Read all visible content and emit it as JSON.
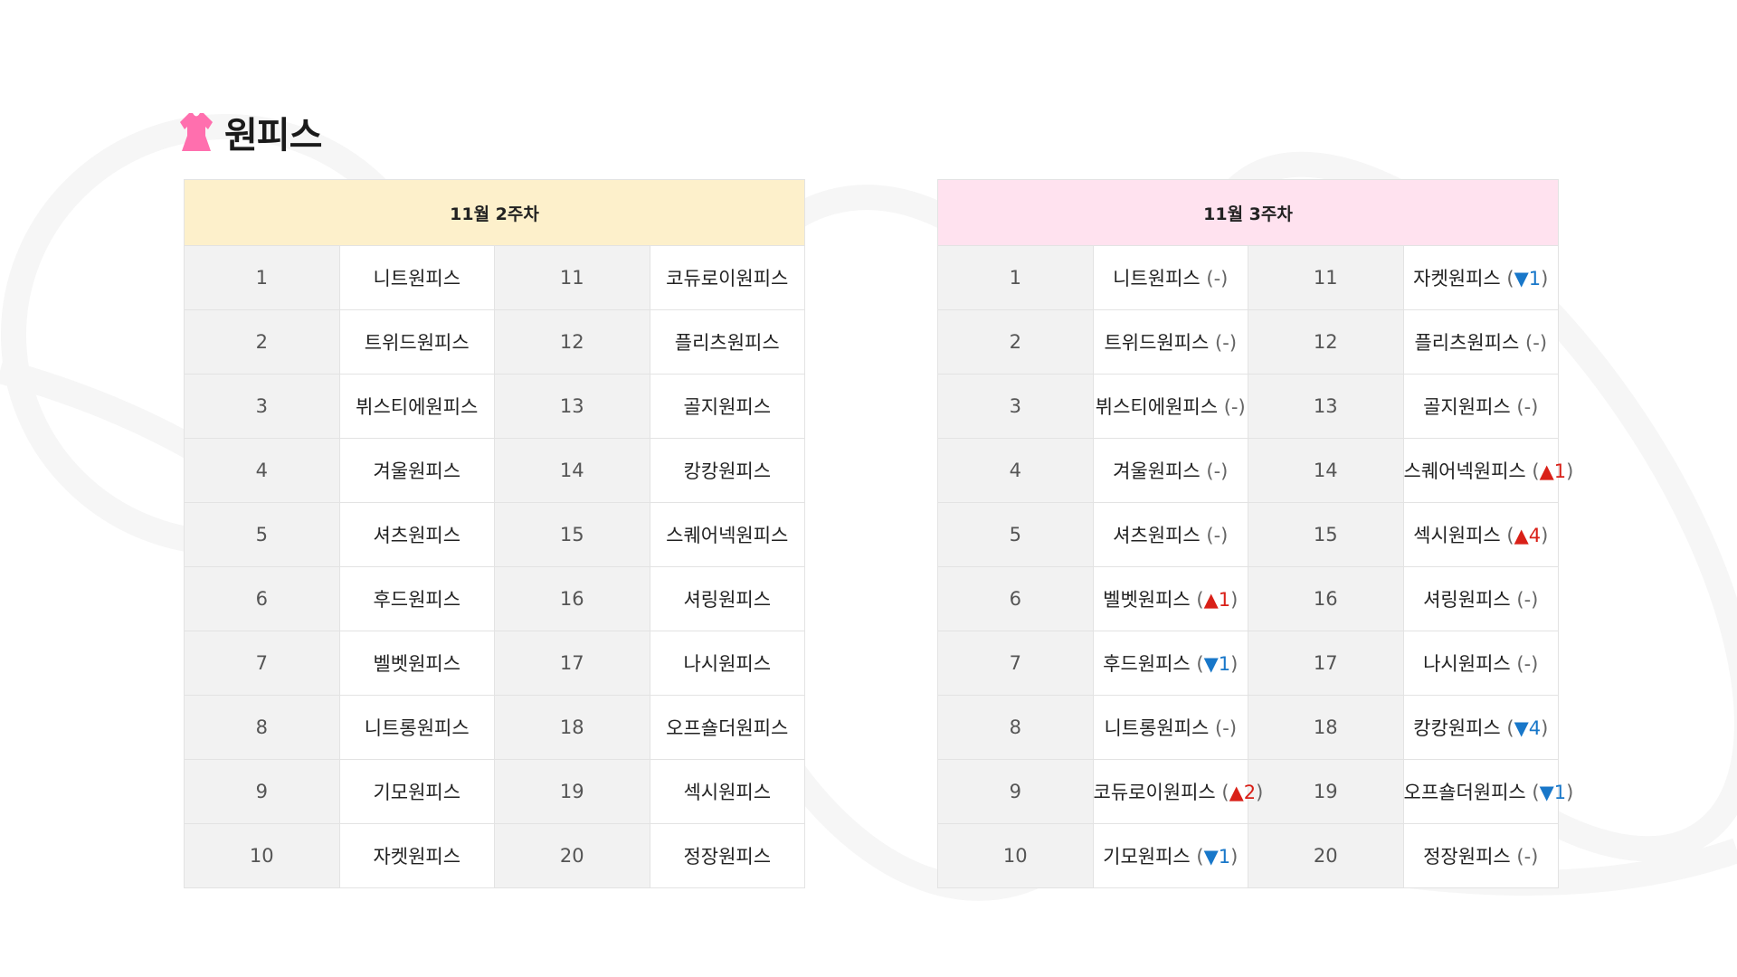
{
  "section": {
    "title": "원피스",
    "icon": "dress-icon",
    "icon_color": "#ff6fae"
  },
  "colors": {
    "week1_header_bg": "#fdf0cb",
    "week2_header_bg": "#ffe2ef",
    "up": "#d92018",
    "down": "#1877c9"
  },
  "week1": {
    "label": "11월 2주차",
    "rows": [
      {
        "rank": "1",
        "name": "니트원피스"
      },
      {
        "rank": "2",
        "name": "트위드원피스"
      },
      {
        "rank": "3",
        "name": "뷔스티에원피스"
      },
      {
        "rank": "4",
        "name": "겨울원피스"
      },
      {
        "rank": "5",
        "name": "셔츠원피스"
      },
      {
        "rank": "6",
        "name": "후드원피스"
      },
      {
        "rank": "7",
        "name": "벨벳원피스"
      },
      {
        "rank": "8",
        "name": "니트롱원피스"
      },
      {
        "rank": "9",
        "name": "기모원피스"
      },
      {
        "rank": "10",
        "name": "자켓원피스"
      },
      {
        "rank": "11",
        "name": "코듀로이원피스"
      },
      {
        "rank": "12",
        "name": "플리츠원피스"
      },
      {
        "rank": "13",
        "name": "골지원피스"
      },
      {
        "rank": "14",
        "name": "캉캉원피스"
      },
      {
        "rank": "15",
        "name": "스퀘어넥원피스"
      },
      {
        "rank": "16",
        "name": "셔링원피스"
      },
      {
        "rank": "17",
        "name": "나시원피스"
      },
      {
        "rank": "18",
        "name": "오프숄더원피스"
      },
      {
        "rank": "19",
        "name": "섹시원피스"
      },
      {
        "rank": "20",
        "name": "정장원피스"
      }
    ]
  },
  "week2": {
    "label": "11월 3주차",
    "rows": [
      {
        "rank": "1",
        "name": "니트원피스",
        "ch_open": " (",
        "ch_mark": "-",
        "ch_close": ")",
        "ch_dir": "same"
      },
      {
        "rank": "2",
        "name": "트위드원피스",
        "ch_open": " (",
        "ch_mark": "-",
        "ch_close": ")",
        "ch_dir": "same"
      },
      {
        "rank": "3",
        "name": "뷔스티에원피스",
        "ch_open": " (",
        "ch_mark": "-",
        "ch_close": ")",
        "ch_dir": "same"
      },
      {
        "rank": "4",
        "name": "겨울원피스",
        "ch_open": " (",
        "ch_mark": "-",
        "ch_close": ")",
        "ch_dir": "same"
      },
      {
        "rank": "5",
        "name": "셔츠원피스",
        "ch_open": " (",
        "ch_mark": "-",
        "ch_close": ")",
        "ch_dir": "same"
      },
      {
        "rank": "6",
        "name": "벨벳원피스",
        "ch_open": " (",
        "ch_mark": "▲1",
        "ch_close": ")",
        "ch_dir": "up"
      },
      {
        "rank": "7",
        "name": "후드원피스",
        "ch_open": " (",
        "ch_mark": "▼1",
        "ch_close": ")",
        "ch_dir": "down"
      },
      {
        "rank": "8",
        "name": "니트롱원피스",
        "ch_open": " (",
        "ch_mark": "-",
        "ch_close": ")",
        "ch_dir": "same"
      },
      {
        "rank": "9",
        "name": "코듀로이원피스",
        "ch_open": " (",
        "ch_mark": "▲2",
        "ch_close": ")",
        "ch_dir": "up"
      },
      {
        "rank": "10",
        "name": "기모원피스",
        "ch_open": " (",
        "ch_mark": "▼1",
        "ch_close": ")",
        "ch_dir": "down"
      },
      {
        "rank": "11",
        "name": "자켓원피스",
        "ch_open": " (",
        "ch_mark": "▼1",
        "ch_close": ")",
        "ch_dir": "down"
      },
      {
        "rank": "12",
        "name": "플리츠원피스",
        "ch_open": " (",
        "ch_mark": "-",
        "ch_close": ")",
        "ch_dir": "same"
      },
      {
        "rank": "13",
        "name": "골지원피스",
        "ch_open": " (",
        "ch_mark": "-",
        "ch_close": ")",
        "ch_dir": "same"
      },
      {
        "rank": "14",
        "name": "스퀘어넥원피스",
        "ch_open": " (",
        "ch_mark": "▲1",
        "ch_close": ")",
        "ch_dir": "up"
      },
      {
        "rank": "15",
        "name": "섹시원피스",
        "ch_open": " (",
        "ch_mark": "▲4",
        "ch_close": ")",
        "ch_dir": "up"
      },
      {
        "rank": "16",
        "name": "셔링원피스",
        "ch_open": " (",
        "ch_mark": "-",
        "ch_close": ")",
        "ch_dir": "same"
      },
      {
        "rank": "17",
        "name": "나시원피스",
        "ch_open": " (",
        "ch_mark": "-",
        "ch_close": ")",
        "ch_dir": "same"
      },
      {
        "rank": "18",
        "name": "캉캉원피스",
        "ch_open": " (",
        "ch_mark": "▼4",
        "ch_close": ")",
        "ch_dir": "down"
      },
      {
        "rank": "19",
        "name": "오프숄더원피스",
        "ch_open": " (",
        "ch_mark": "▼1",
        "ch_close": ")",
        "ch_dir": "down"
      },
      {
        "rank": "20",
        "name": "정장원피스",
        "ch_open": " (",
        "ch_mark": "-",
        "ch_close": ")",
        "ch_dir": "same"
      }
    ]
  }
}
